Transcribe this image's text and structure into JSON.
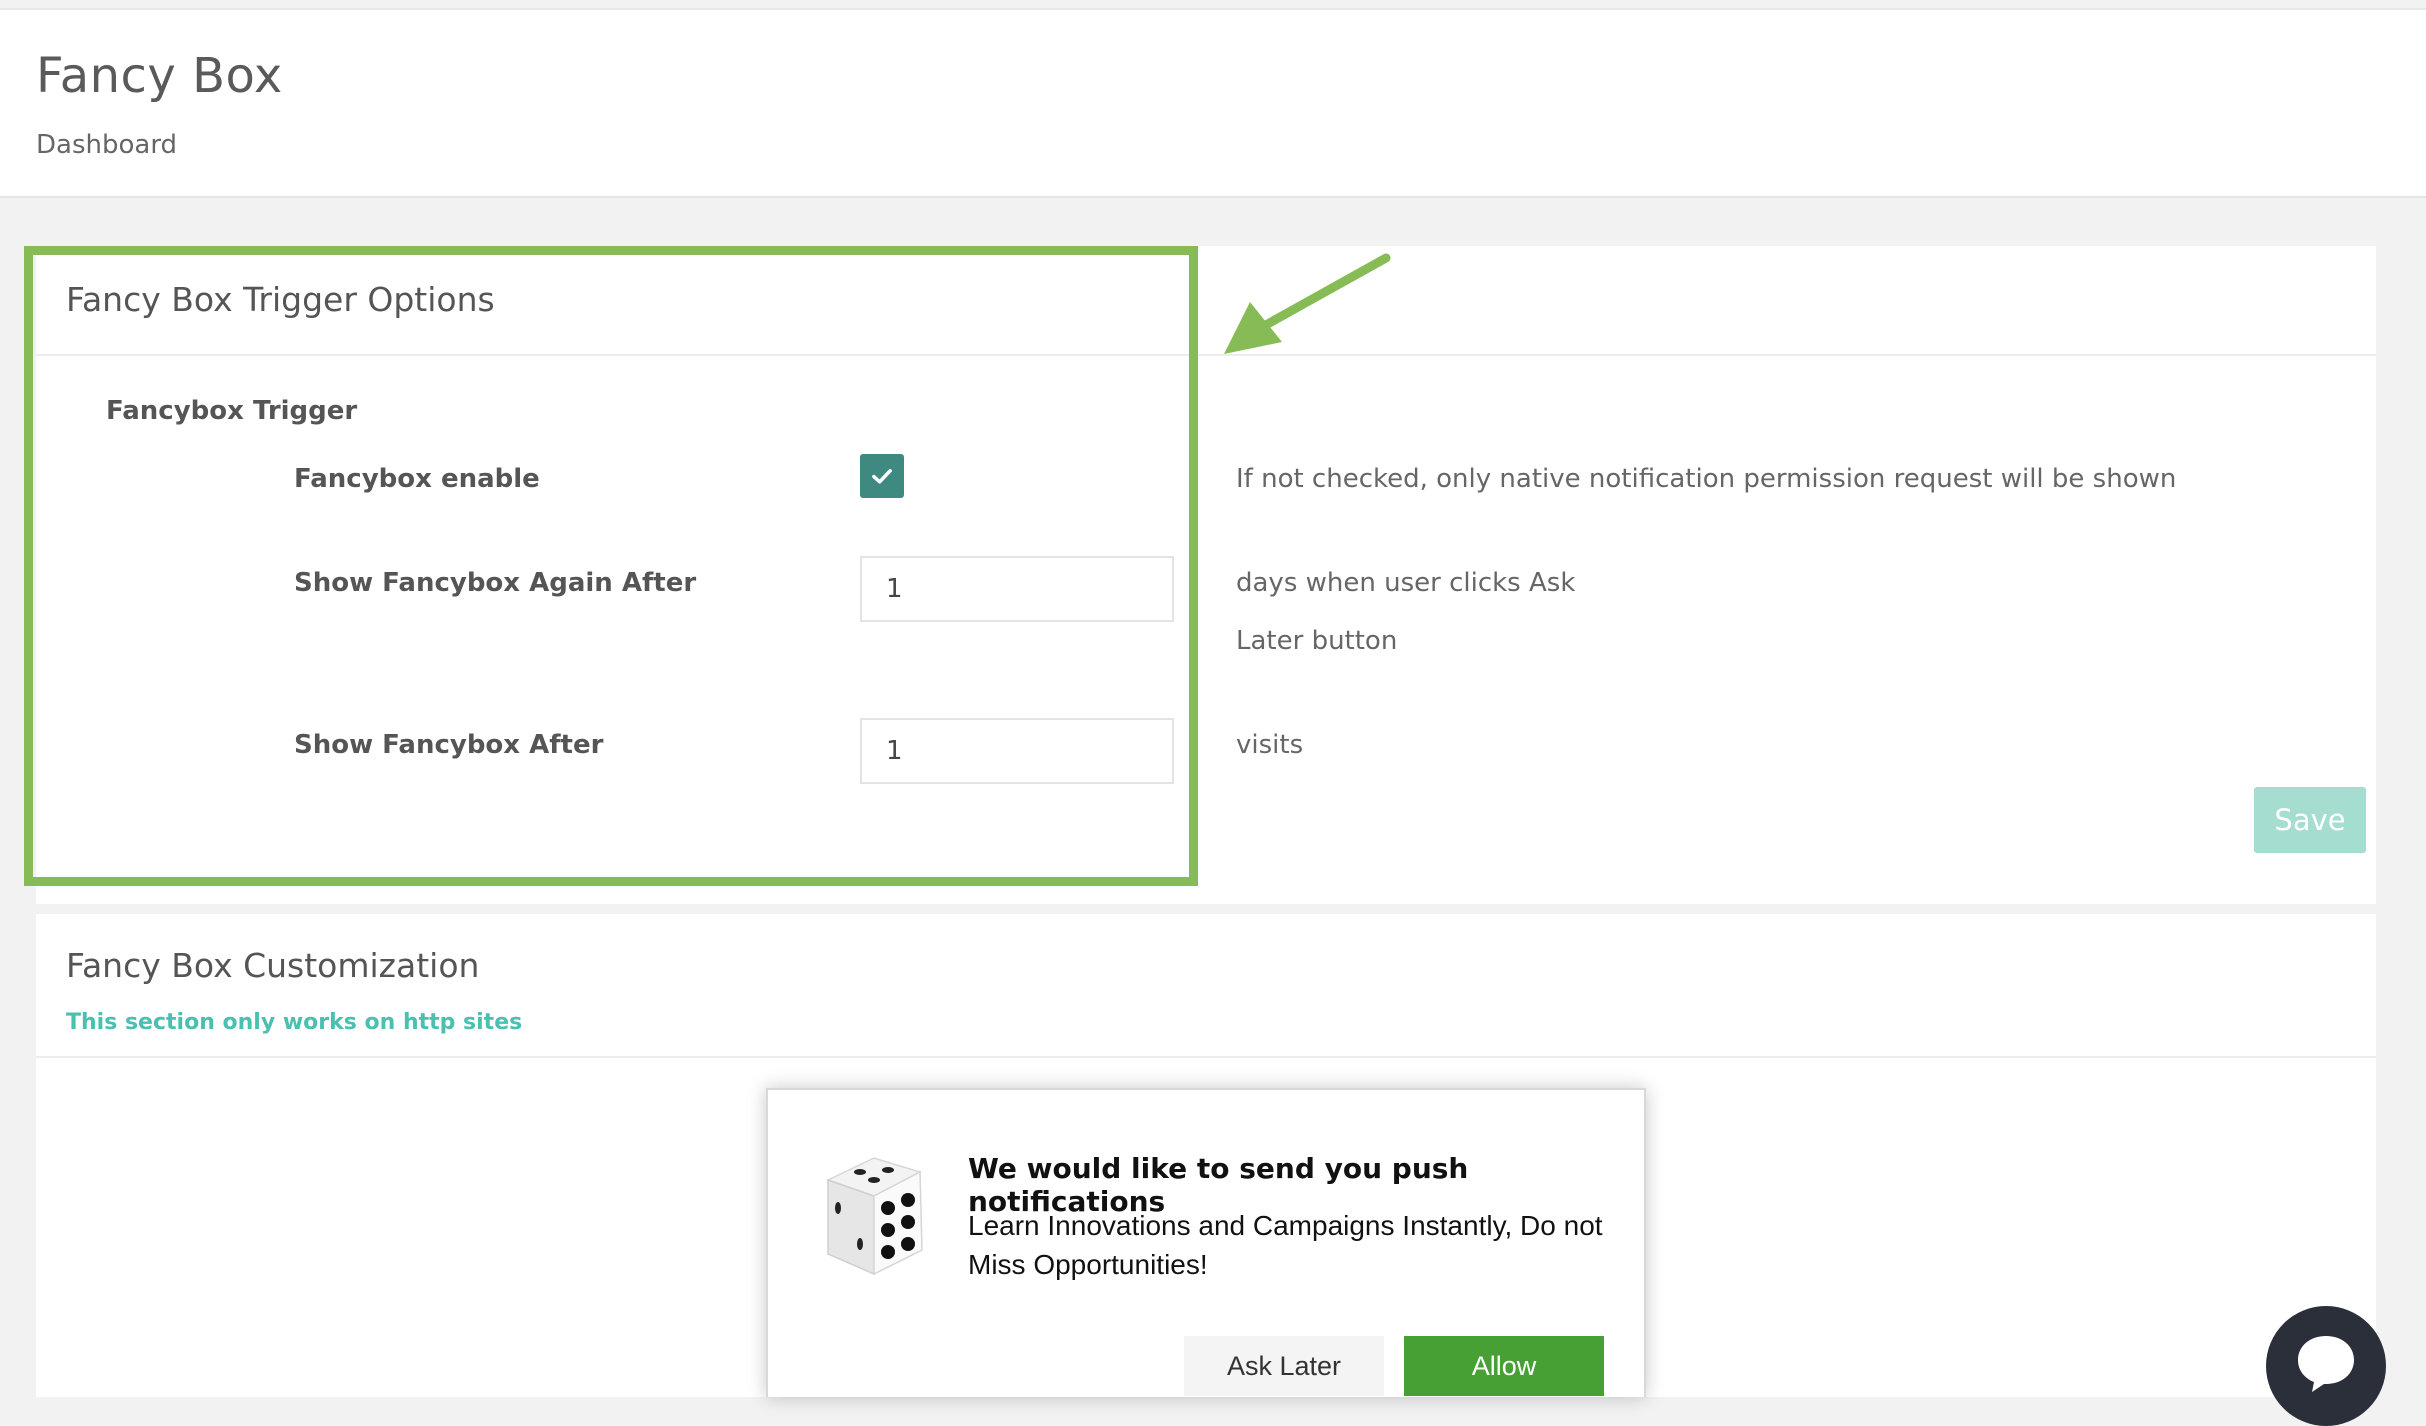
{
  "header": {
    "title": "Fancy Box",
    "breadcrumb": "Dashboard"
  },
  "trigger_panel": {
    "title": "Fancy Box Trigger Options",
    "group_label": "Fancybox Trigger",
    "enable": {
      "label": "Fancybox enable",
      "checked": true,
      "help": "If not checked, only native notification permission request will be shown"
    },
    "show_again": {
      "label": "Show Fancybox Again After",
      "value": "1",
      "help_line1": "days when user clicks Ask",
      "help_line2": "Later button"
    },
    "show_after": {
      "label": "Show Fancybox After",
      "value": "1",
      "help": "visits"
    },
    "save_label": "Save"
  },
  "customization_panel": {
    "title": "Fancy Box Customization",
    "note": "This section only works on http sites"
  },
  "preview": {
    "image_icon": "dice-icon",
    "title": "We would like to send you push notifications",
    "body": "Learn Innovations and Campaigns Instantly, Do not Miss Opportunities!",
    "ask_later_label": "Ask Later",
    "allow_label": "Allow"
  },
  "colors": {
    "highlight": "#86bb55",
    "checkbox": "#3e8a80",
    "save": "#a6ddd1",
    "note": "#4bbfb0",
    "allow": "#47a034"
  }
}
